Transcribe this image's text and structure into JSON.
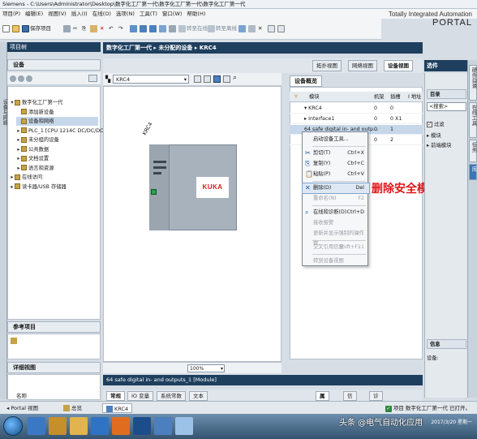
{
  "window": {
    "title": "Siemens - C:\\Users\\Administrator\\Desktop\\数字化工厂第一代\\数字化工厂第一代\\数字化工厂第一代"
  },
  "branding": {
    "line1": "Totally Integrated Automation",
    "line2": "PORTAL"
  },
  "menu": [
    "项目(P)",
    "编辑(E)",
    "视图(V)",
    "插入(I)",
    "在线(O)",
    "选项(N)",
    "工具(T)",
    "窗口(W)",
    "帮助(H)"
  ],
  "toolbar": {
    "save_label": "保存项目",
    "go_online": "转至在线",
    "go_offline": "转至离线"
  },
  "project_panel": {
    "header": "项目树",
    "devices_tab": "设备",
    "tree": [
      {
        "label": "数字化工厂第一代",
        "level": 0,
        "toggle": "▾"
      },
      {
        "label": "添加新设备",
        "level": 1,
        "toggle": ""
      },
      {
        "label": "设备和网络",
        "level": 1,
        "toggle": ""
      },
      {
        "label": "PLC_1 [CPU 1214C DC/DC/DC]",
        "level": 1,
        "toggle": "▸"
      },
      {
        "label": "未分组的设备",
        "level": 1,
        "toggle": "▸"
      },
      {
        "label": "公共数据",
        "level": 1,
        "toggle": "▸"
      },
      {
        "label": "文档设置",
        "level": 1,
        "toggle": "▸"
      },
      {
        "label": "语言和资源",
        "level": 1,
        "toggle": "▸"
      },
      {
        "label": "在线访问",
        "level": 0,
        "toggle": "▸"
      },
      {
        "label": "读卡器/USB 存储器",
        "level": 0,
        "toggle": "▸"
      }
    ],
    "reference_header": "参考项目",
    "detail_header": "详细视图",
    "detail_col": "名称",
    "side_tabs": [
      "设备与网络"
    ]
  },
  "editor": {
    "breadcrumb": "数字化工厂第一代 ▸ 未分配的设备 ▸ KRC4",
    "views": {
      "topology": "拓扑视图",
      "network": "网络视图",
      "device": "设备视图"
    },
    "device_select": "KRC4",
    "zoom": "100%",
    "device_label": "KRC4",
    "logo_text": "KUKA"
  },
  "overview": {
    "tab": "设备概览",
    "columns": [
      "模块",
      "机架",
      "插槽",
      "I 地址"
    ],
    "rows": [
      {
        "module": "▾ KRC4",
        "rack": "0",
        "slot": "0",
        "addr": ""
      },
      {
        "module": "▸ Interface1",
        "rack": "0",
        "slot": "0 X1",
        "addr": ""
      },
      {
        "module": "64 safe digital in- and outp...",
        "rack": "0",
        "slot": "1",
        "addr": ""
      },
      {
        "module": "...tput_1",
        "rack": "0",
        "slot": "2",
        "addr": ""
      }
    ]
  },
  "context_menu": {
    "items": [
      {
        "label": "启动设备工具...",
        "shortcut": "",
        "disabled": false,
        "icon": ""
      },
      {
        "label": "剪切(T)",
        "shortcut": "Ctrl+X",
        "disabled": false,
        "icon": "✂"
      },
      {
        "label": "复制(Y)",
        "shortcut": "Ctrl+C",
        "disabled": false,
        "icon": "⎘"
      },
      {
        "label": "粘贴(P)",
        "shortcut": "Ctrl+V",
        "disabled": false,
        "icon": "📋"
      },
      {
        "label": "删除(D)",
        "shortcut": "Del",
        "disabled": false,
        "icon": "✕",
        "active": true
      },
      {
        "label": "重命名(N)",
        "shortcut": "F2",
        "disabled": true,
        "icon": ""
      },
      {
        "label": "在线和诊断(D)",
        "shortcut": "Ctrl+D",
        "disabled": false,
        "icon": "⌕"
      },
      {
        "label": "接收报警",
        "shortcut": "",
        "disabled": true,
        "icon": ""
      },
      {
        "label": "更新并显示强制的操作数",
        "shortcut": "",
        "disabled": true,
        "icon": ""
      },
      {
        "label": "交叉引用信息",
        "shortcut": "Shift+F11",
        "disabled": true,
        "icon": ""
      },
      {
        "label": "转到设备视图",
        "shortcut": "",
        "disabled": true,
        "icon": ""
      }
    ]
  },
  "annotation": "删除安全模块",
  "inspector": {
    "header": "64 safe digital in- and outputs_1 [Module]",
    "tabs": [
      "常规",
      "IO 变量",
      "系统常数",
      "文本"
    ],
    "prop_tabs": [
      "属性",
      "信息",
      "诊断"
    ]
  },
  "task_panel": {
    "header": "选件",
    "catalog_header": "目录",
    "search_placeholder": "<搜索>",
    "filter_label": "过滤",
    "catalog_items": [
      "模块",
      "前端模块"
    ],
    "info_header": "信息",
    "info_device": "设备:",
    "side_tabs": [
      "硬件目录",
      "在线工具",
      "任务",
      "库"
    ]
  },
  "portal_bar": {
    "portal_view": "Portal 视图",
    "overview_btn": "总览",
    "open_editor": "KRC4",
    "status": "项目 数字化工厂第一代 已打开。"
  },
  "taskbar": {
    "watermark": "头条 @电气自动化应用",
    "time": "",
    "date": "2017/3/20 星期一"
  },
  "colors": {
    "accent": "#1e3f5e",
    "annotation": "#e0161b",
    "kuka": "#e4151a",
    "port": "#2aa04b"
  }
}
